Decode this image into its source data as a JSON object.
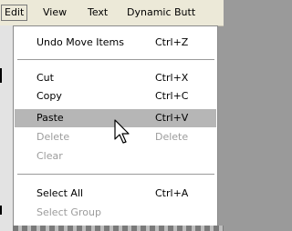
{
  "menubar": {
    "items": [
      {
        "label": "Edit",
        "active": true
      },
      {
        "label": "View"
      },
      {
        "label": "Text"
      },
      {
        "label": "Dynamic Butt"
      }
    ]
  },
  "edit_menu": {
    "items": [
      {
        "label": "Undo Move Items",
        "shortcut": "Ctrl+Z",
        "enabled": true
      },
      {
        "label": "Cut",
        "shortcut": "Ctrl+X",
        "enabled": true
      },
      {
        "label": "Copy",
        "shortcut": "Ctrl+C",
        "enabled": true
      },
      {
        "label": "Paste",
        "shortcut": "Ctrl+V",
        "enabled": true,
        "highlighted": true
      },
      {
        "label": "Delete",
        "shortcut": "Delete",
        "enabled": false
      },
      {
        "label": "Clear",
        "shortcut": "",
        "enabled": false
      },
      {
        "label": "Select All",
        "shortcut": "Ctrl+A",
        "enabled": true
      },
      {
        "label": "Select Group",
        "shortcut": "",
        "enabled": false
      }
    ]
  },
  "icons": {
    "cursor": "mouse-pointer-icon"
  },
  "colors": {
    "menubar_bg": "#ece9d8",
    "highlight_bg": "#b6b6b6",
    "disabled_text": "#9c9c9c"
  }
}
